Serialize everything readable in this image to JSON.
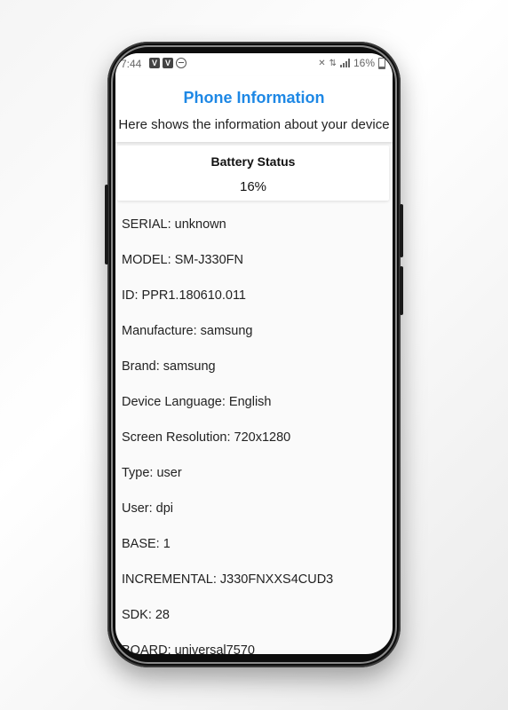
{
  "status_bar": {
    "time": "7:44",
    "badge1": "V",
    "badge2": "V",
    "battery_text": "16%",
    "icons": [
      "mute-icon",
      "data-icon",
      "signal-icon",
      "battery-icon",
      "dnd-icon"
    ]
  },
  "header": {
    "title": "Phone Information",
    "subtitle": "Here shows the information about your device",
    "title_color": "#1e88e5"
  },
  "battery": {
    "title": "Battery Status",
    "value": "16%"
  },
  "info": [
    "SERIAL: unknown",
    "MODEL: SM-J330FN",
    "ID: PPR1.180610.011",
    "Manufacture: samsung",
    "Brand: samsung",
    "Device Language: English",
    "Screen Resolution: 720x1280",
    "Type: user",
    "User: dpi",
    "BASE: 1",
    "INCREMENTAL: J330FNXXS4CUD3",
    "SDK: 28",
    "BOARD: universal7570"
  ]
}
